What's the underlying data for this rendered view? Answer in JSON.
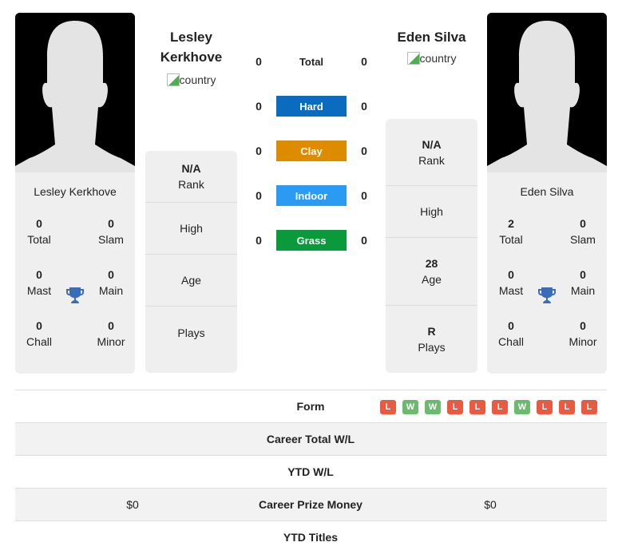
{
  "player1": {
    "name": "Lesley Kerkhove",
    "name_line1": "Lesley",
    "name_line2": "Kerkhove",
    "country_alt": "country",
    "titles": {
      "total": {
        "value": "0",
        "label": "Total"
      },
      "slam": {
        "value": "0",
        "label": "Slam"
      },
      "mast": {
        "value": "0",
        "label": "Mast"
      },
      "main": {
        "value": "0",
        "label": "Main"
      },
      "chall": {
        "value": "0",
        "label": "Chall"
      },
      "minor": {
        "value": "0",
        "label": "Minor"
      }
    },
    "info": {
      "rank": {
        "value": "N/A",
        "label": "Rank"
      },
      "high": {
        "value": "",
        "label": "High"
      },
      "age": {
        "value": "",
        "label": "Age"
      },
      "plays": {
        "value": "",
        "label": "Plays"
      }
    }
  },
  "player2": {
    "name": "Eden Silva",
    "country_alt": "country",
    "titles": {
      "total": {
        "value": "2",
        "label": "Total"
      },
      "slam": {
        "value": "0",
        "label": "Slam"
      },
      "mast": {
        "value": "0",
        "label": "Mast"
      },
      "main": {
        "value": "0",
        "label": "Main"
      },
      "chall": {
        "value": "0",
        "label": "Chall"
      },
      "minor": {
        "value": "0",
        "label": "Minor"
      }
    },
    "info": {
      "rank": {
        "value": "N/A",
        "label": "Rank"
      },
      "high": {
        "value": "",
        "label": "High"
      },
      "age": {
        "value": "28",
        "label": "Age"
      },
      "plays": {
        "value": "R",
        "label": "Plays"
      }
    }
  },
  "surfaces": [
    {
      "label": "Total",
      "p1": "0",
      "p2": "0",
      "color": ""
    },
    {
      "label": "Hard",
      "p1": "0",
      "p2": "0",
      "color": "#0b6bbf"
    },
    {
      "label": "Clay",
      "p1": "0",
      "p2": "0",
      "color": "#dd8c00"
    },
    {
      "label": "Indoor",
      "p1": "0",
      "p2": "0",
      "color": "#2b9af3"
    },
    {
      "label": "Grass",
      "p1": "0",
      "p2": "0",
      "color": "#0a9a3c"
    }
  ],
  "stats": {
    "form_label": "Form",
    "form": [
      "L",
      "W",
      "W",
      "L",
      "L",
      "L",
      "W",
      "L",
      "L",
      "L"
    ],
    "form_colors": {
      "W": "#6cba6e",
      "L": "#ea5a40"
    },
    "career_wl": {
      "label": "Career Total W/L",
      "p1": "",
      "p2": ""
    },
    "ytd_wl": {
      "label": "YTD W/L",
      "p1": "",
      "p2": ""
    },
    "prize": {
      "label": "Career Prize Money",
      "p1": "$0",
      "p2": "$0"
    },
    "ytd_titles": {
      "label": "YTD Titles",
      "p1": "",
      "p2": ""
    }
  },
  "colors": {
    "trophy": "#3a6db5",
    "card_bg": "#efefef"
  }
}
